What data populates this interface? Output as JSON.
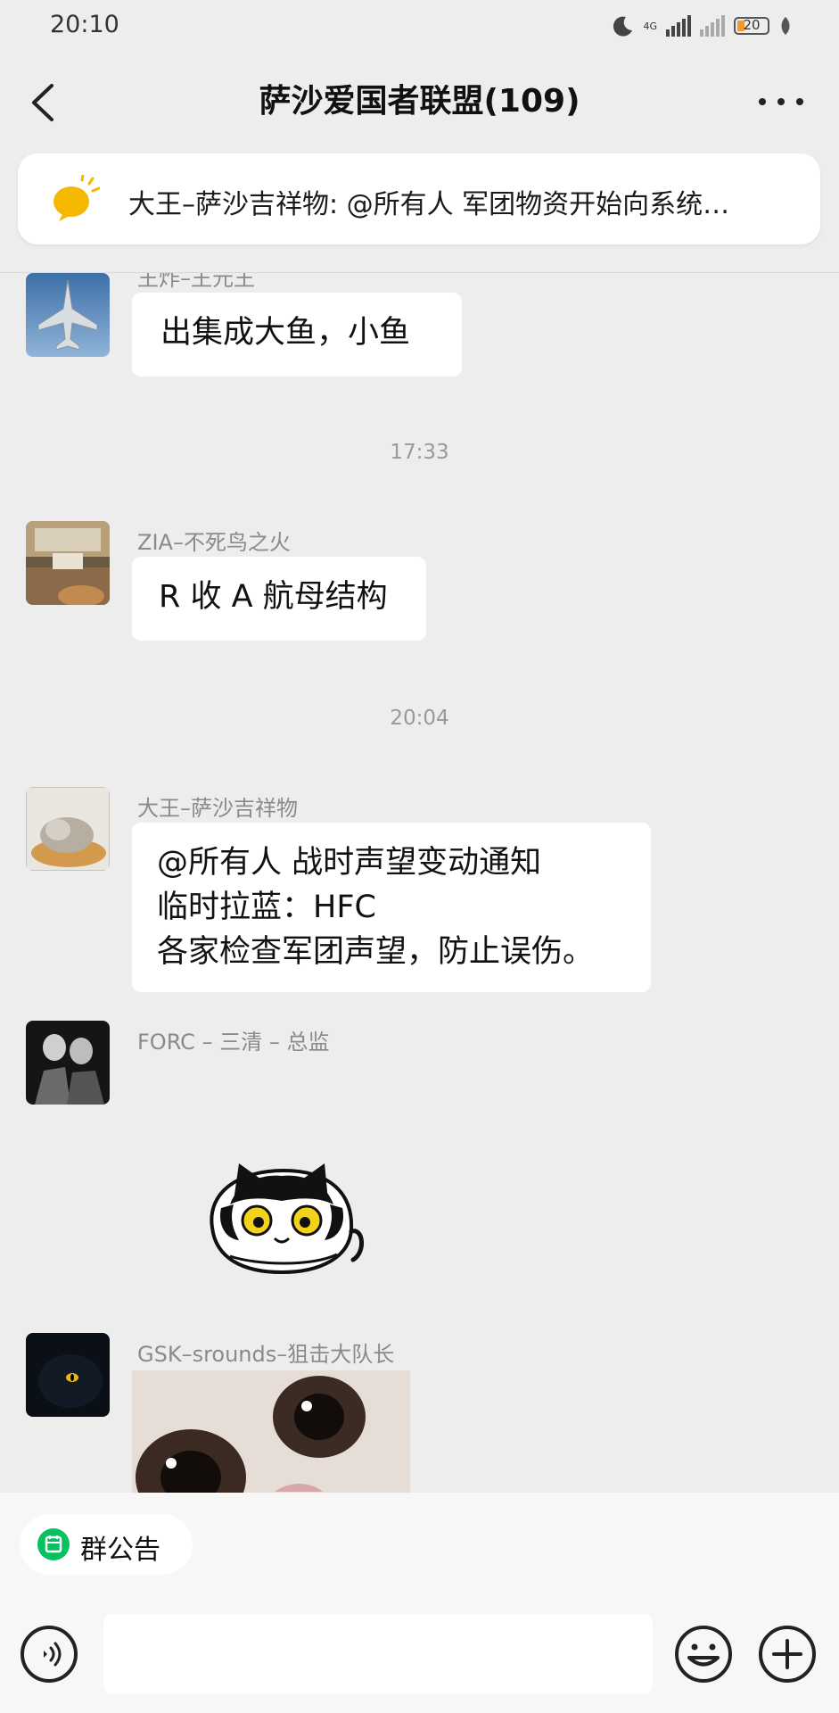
{
  "status_bar": {
    "time": "20:10",
    "network": "4G",
    "battery": "20"
  },
  "nav": {
    "title": "萨沙爱国者联盟(109)"
  },
  "pinned": {
    "text": "大王–萨沙吉祥物: @所有人 军团物资开始向系统…"
  },
  "messages": {
    "m0": {
      "sender": "王炸–王元王",
      "text": "出集成大鱼，小鱼"
    },
    "t1": "17:33",
    "m1": {
      "sender": "ZIA–不死鸟之火",
      "text": "R 收 A 航母结构"
    },
    "t2": "20:04",
    "m2": {
      "sender": "大王–萨沙吉祥物",
      "lines": [
        "@所有人  战时声望变动通知",
        "临时拉蓝：HFC",
        "各家检查军团声望，防止误伤。"
      ]
    },
    "m3": {
      "sender": "FORC – 三清 – 总监"
    },
    "m4": {
      "sender": "GSK–srounds–狙击大队长"
    }
  },
  "bottom": {
    "notice_label": "群公告"
  },
  "colors": {
    "background": "#ededed",
    "accent": "#07c160",
    "pin_icon": "#f5b800"
  }
}
